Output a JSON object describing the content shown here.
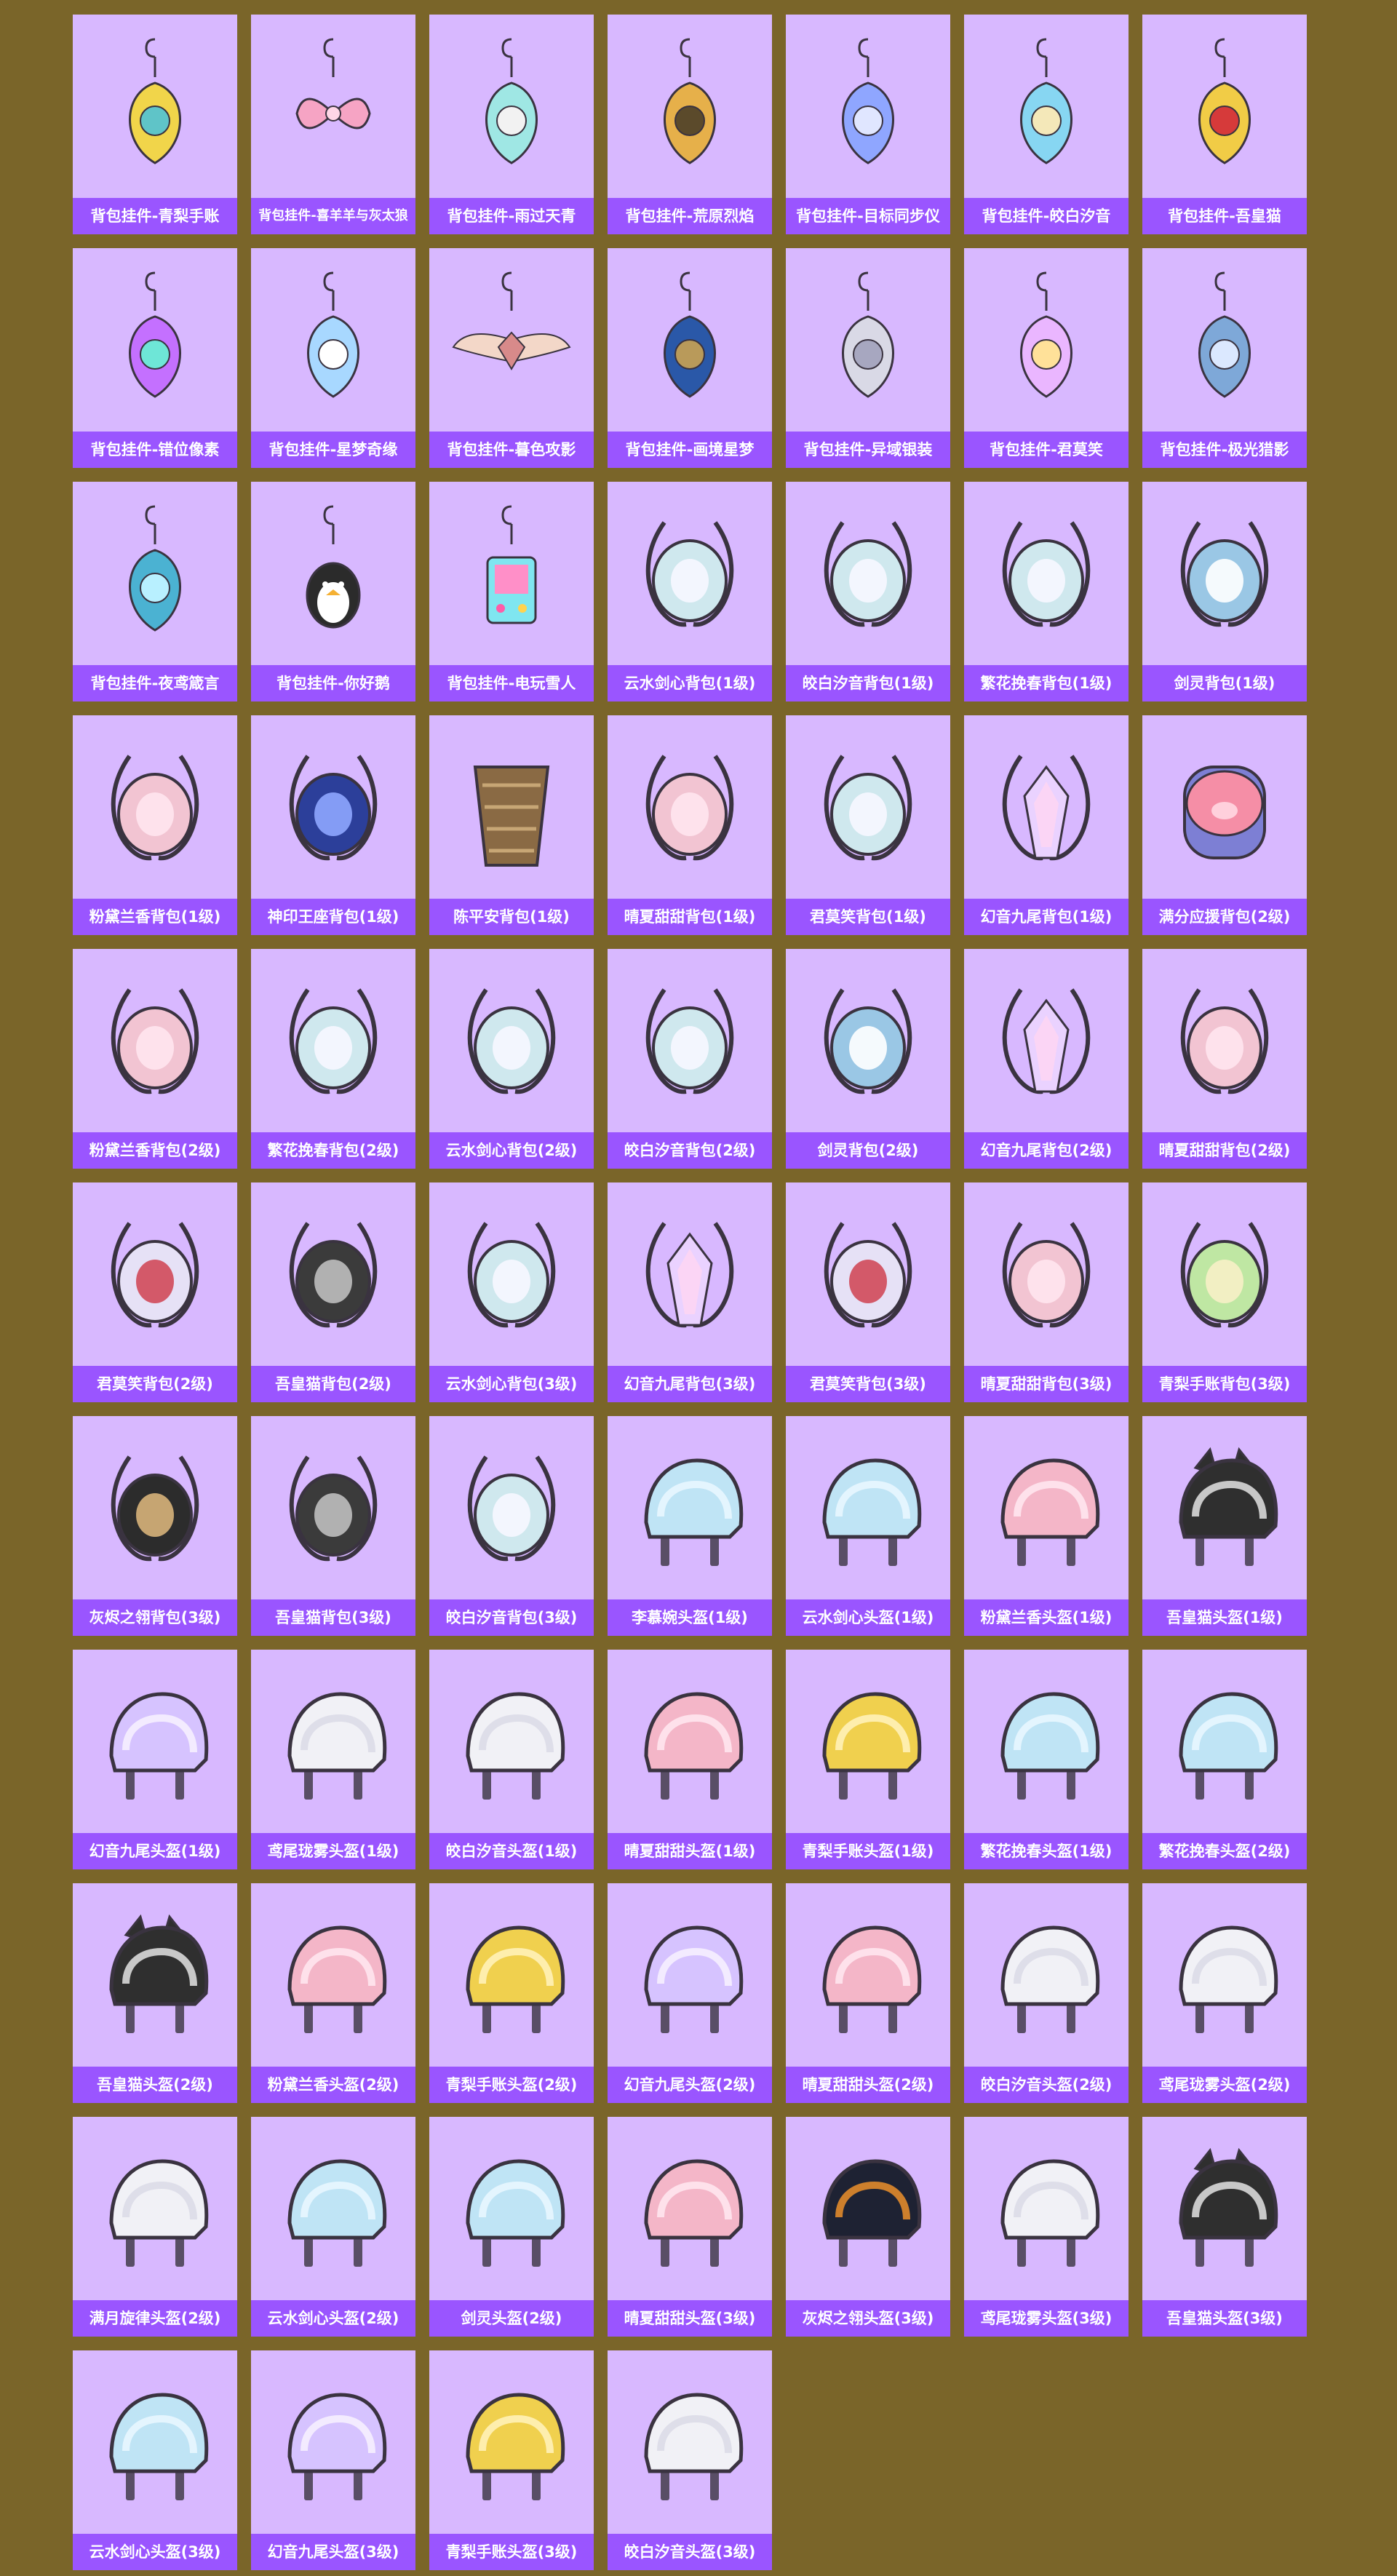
{
  "colors": {
    "background": "#7a6529",
    "card": "#d8b8ff",
    "label_bar": "#9a55ff",
    "label_text": "#ffffff"
  },
  "items": [
    {
      "name": "背包挂件-青梨手账",
      "icon": "pendant-pear"
    },
    {
      "name": "背包挂件-喜羊羊与灰太狼",
      "icon": "pendant-bow"
    },
    {
      "name": "背包挂件-雨过天青",
      "icon": "pendant-sword"
    },
    {
      "name": "背包挂件-荒原烈焰",
      "icon": "pendant-flame"
    },
    {
      "name": "背包挂件-目标同步仪",
      "icon": "pendant-ring"
    },
    {
      "name": "背包挂件-皎白汐音",
      "icon": "pendant-crystal"
    },
    {
      "name": "背包挂件-吾皇猫",
      "icon": "pendant-bell"
    },
    {
      "name": "背包挂件-错位像素",
      "icon": "pendant-triangle"
    },
    {
      "name": "背包挂件-星梦奇缘",
      "icon": "pendant-snowflake"
    },
    {
      "name": "背包挂件-暮色攻影",
      "icon": "pendant-wings"
    },
    {
      "name": "背包挂件-画境星梦",
      "icon": "pendant-orb"
    },
    {
      "name": "背包挂件-异域银装",
      "icon": "pendant-emblem"
    },
    {
      "name": "背包挂件-君莫笑",
      "icon": "pendant-blade"
    },
    {
      "name": "背包挂件-极光猎影",
      "icon": "pendant-crossbow"
    },
    {
      "name": "背包挂件-夜鸢箴言",
      "icon": "pendant-beetle"
    },
    {
      "name": "背包挂件-你好鹅",
      "icon": "pendant-penguin"
    },
    {
      "name": "背包挂件-电玩雪人",
      "icon": "pendant-arcade"
    },
    {
      "name": "云水剑心背包(1级)",
      "icon": "backpack"
    },
    {
      "name": "皎白汐音背包(1级)",
      "icon": "backpack"
    },
    {
      "name": "繁花挽春背包(1级)",
      "icon": "backpack"
    },
    {
      "name": "剑灵背包(1级)",
      "icon": "backpack-ornament"
    },
    {
      "name": "粉黛兰香背包(1级)",
      "icon": "backpack-pink"
    },
    {
      "name": "神印王座背包(1级)",
      "icon": "backpack-blue"
    },
    {
      "name": "陈平安背包(1级)",
      "icon": "backpack-basket"
    },
    {
      "name": "晴夏甜甜背包(1级)",
      "icon": "backpack-pink"
    },
    {
      "name": "君莫笑背包(1级)",
      "icon": "backpack"
    },
    {
      "name": "幻音九尾背包(1级)",
      "icon": "backpack-crystal"
    },
    {
      "name": "满分应援背包(2级)",
      "icon": "backpack-pig"
    },
    {
      "name": "粉黛兰香背包(2级)",
      "icon": "backpack-pink"
    },
    {
      "name": "繁花挽春背包(2级)",
      "icon": "backpack"
    },
    {
      "name": "云水剑心背包(2级)",
      "icon": "backpack"
    },
    {
      "name": "皎白汐音背包(2级)",
      "icon": "backpack"
    },
    {
      "name": "剑灵背包(2级)",
      "icon": "backpack-ornament"
    },
    {
      "name": "幻音九尾背包(2级)",
      "icon": "backpack-crystal"
    },
    {
      "name": "晴夏甜甜背包(2级)",
      "icon": "backpack-pink"
    },
    {
      "name": "君莫笑背包(2级)",
      "icon": "backpack-emblem"
    },
    {
      "name": "吾皇猫背包(2级)",
      "icon": "backpack-cat"
    },
    {
      "name": "云水剑心背包(3级)",
      "icon": "backpack"
    },
    {
      "name": "幻音九尾背包(3级)",
      "icon": "backpack-crystal"
    },
    {
      "name": "君莫笑背包(3级)",
      "icon": "backpack-emblem"
    },
    {
      "name": "晴夏甜甜背包(3级)",
      "icon": "backpack-pink"
    },
    {
      "name": "青梨手账背包(3级)",
      "icon": "backpack-green"
    },
    {
      "name": "灰烬之翎背包(3级)",
      "icon": "backpack-dark"
    },
    {
      "name": "吾皇猫背包(3级)",
      "icon": "backpack-cat"
    },
    {
      "name": "皎白汐音背包(3级)",
      "icon": "backpack"
    },
    {
      "name": "李慕婉头盔(1级)",
      "icon": "helmet-blue"
    },
    {
      "name": "云水剑心头盔(1级)",
      "icon": "helmet-blue"
    },
    {
      "name": "粉黛兰香头盔(1级)",
      "icon": "helmet-pink"
    },
    {
      "name": "吾皇猫头盔(1级)",
      "icon": "helmet-cat"
    },
    {
      "name": "幻音九尾头盔(1级)",
      "icon": "helmet-purple"
    },
    {
      "name": "鸢尾珑雾头盔(1级)",
      "icon": "helmet-white"
    },
    {
      "name": "皎白汐音头盔(1级)",
      "icon": "helmet-white"
    },
    {
      "name": "晴夏甜甜头盔(1级)",
      "icon": "helmet-pink"
    },
    {
      "name": "青梨手账头盔(1级)",
      "icon": "helmet-yellow"
    },
    {
      "name": "繁花挽春头盔(1级)",
      "icon": "helmet-blue"
    },
    {
      "name": "繁花挽春头盔(2级)",
      "icon": "helmet-blue"
    },
    {
      "name": "吾皇猫头盔(2级)",
      "icon": "helmet-cat"
    },
    {
      "name": "粉黛兰香头盔(2级)",
      "icon": "helmet-pink"
    },
    {
      "name": "青梨手账头盔(2级)",
      "icon": "helmet-yellow"
    },
    {
      "name": "幻音九尾头盔(2级)",
      "icon": "helmet-purple"
    },
    {
      "name": "晴夏甜甜头盔(2级)",
      "icon": "helmet-pink"
    },
    {
      "name": "皎白汐音头盔(2级)",
      "icon": "helmet-white"
    },
    {
      "name": "鸢尾珑雾头盔(2级)",
      "icon": "helmet-white"
    },
    {
      "name": "满月旋律头盔(2级)",
      "icon": "helmet-white"
    },
    {
      "name": "云水剑心头盔(2级)",
      "icon": "helmet-blue"
    },
    {
      "name": "剑灵头盔(2级)",
      "icon": "helmet-blue"
    },
    {
      "name": "晴夏甜甜头盔(3级)",
      "icon": "helmet-pink"
    },
    {
      "name": "灰烬之翎头盔(3级)",
      "icon": "helmet-dark"
    },
    {
      "name": "鸢尾珑雾头盔(3级)",
      "icon": "helmet-white"
    },
    {
      "name": "吾皇猫头盔(3级)",
      "icon": "helmet-cat"
    },
    {
      "name": "云水剑心头盔(3级)",
      "icon": "helmet-blue"
    },
    {
      "name": "幻音九尾头盔(3级)",
      "icon": "helmet-purple"
    },
    {
      "name": "青梨手账头盔(3级)",
      "icon": "helmet-yellow"
    },
    {
      "name": "皎白汐音头盔(3级)",
      "icon": "helmet-white"
    }
  ]
}
